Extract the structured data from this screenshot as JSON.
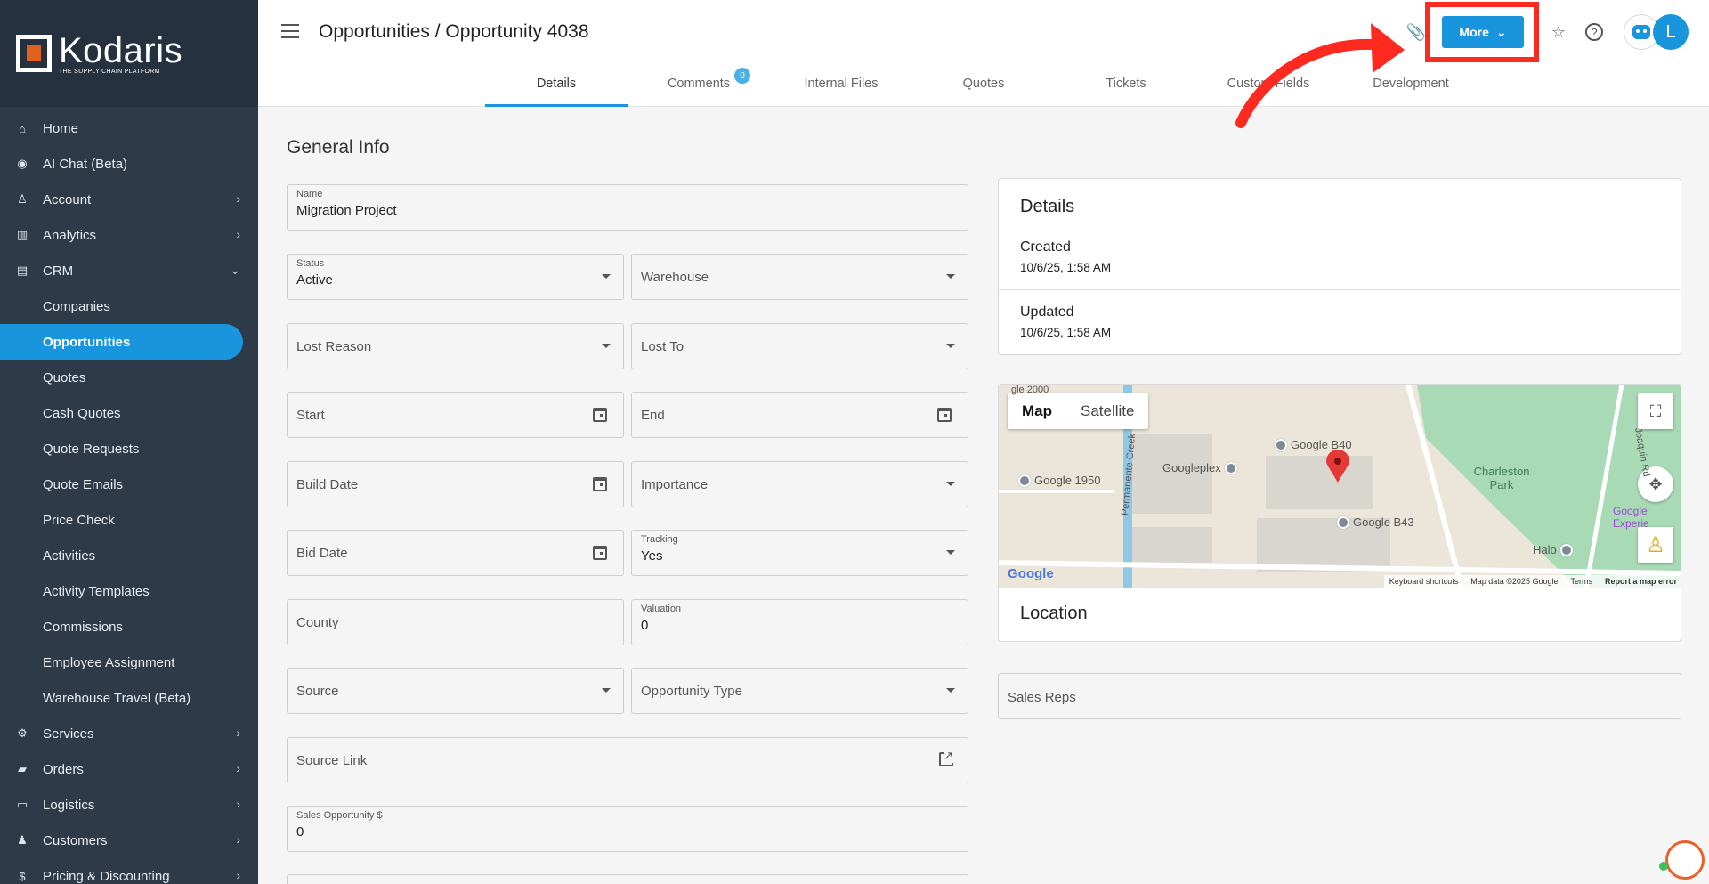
{
  "app": {
    "logo_name": "Kodaris",
    "logo_tagline": "THE SUPPLY CHAIN PLATFORM"
  },
  "sidebar": {
    "items": [
      {
        "label": "Home",
        "icon": "home-icon"
      },
      {
        "label": "AI Chat (Beta)",
        "icon": "robot-icon"
      },
      {
        "label": "Account",
        "icon": "person-icon"
      },
      {
        "label": "Analytics",
        "icon": "chart-icon"
      },
      {
        "label": "CRM",
        "icon": "contacts-icon"
      }
    ],
    "crm_sub": [
      "Companies",
      "Opportunities",
      "Quotes",
      "Cash Quotes",
      "Quote Requests",
      "Quote Emails",
      "Price Check",
      "Activities",
      "Activity Templates",
      "Commissions",
      "Employee Assignment",
      "Warehouse Travel (Beta)"
    ],
    "bottom_items": [
      {
        "label": "Services",
        "icon": "gears-icon"
      },
      {
        "label": "Orders",
        "icon": "truck-icon"
      },
      {
        "label": "Logistics",
        "icon": "shipping-icon"
      },
      {
        "label": "Customers",
        "icon": "group-icon"
      },
      {
        "label": "Pricing & Discounting",
        "icon": "dollar-icon"
      }
    ],
    "active": "Opportunities"
  },
  "header": {
    "title": "Opportunities / Opportunity 4038",
    "more_label": "More",
    "avatar_letter": "L",
    "tabs": [
      {
        "label": "Details",
        "active": true
      },
      {
        "label": "Comments",
        "badge": "0"
      },
      {
        "label": "Internal Files"
      },
      {
        "label": "Quotes"
      },
      {
        "label": "Tickets"
      },
      {
        "label": "Custom Fields"
      },
      {
        "label": "Development"
      }
    ]
  },
  "form": {
    "section_title": "General Info",
    "name": {
      "label": "Name",
      "value": "Migration Project"
    },
    "status": {
      "label": "Status",
      "value": "Active"
    },
    "warehouse": {
      "placeholder": "Warehouse"
    },
    "lost_reason": {
      "placeholder": "Lost Reason"
    },
    "lost_to": {
      "placeholder": "Lost To"
    },
    "start": {
      "placeholder": "Start"
    },
    "end": {
      "placeholder": "End"
    },
    "build_date": {
      "placeholder": "Build Date"
    },
    "importance": {
      "placeholder": "Importance"
    },
    "bid_date": {
      "placeholder": "Bid Date"
    },
    "tracking": {
      "label": "Tracking",
      "value": "Yes"
    },
    "county": {
      "placeholder": "County"
    },
    "valuation": {
      "label": "Valuation",
      "value": "0"
    },
    "source": {
      "placeholder": "Source"
    },
    "opportunity_type": {
      "placeholder": "Opportunity Type"
    },
    "source_link": {
      "placeholder": "Source Link"
    },
    "sales_opportunity": {
      "label": "Sales Opportunity $",
      "value": "0"
    }
  },
  "details": {
    "title": "Details",
    "created_label": "Created",
    "created_value": "10/6/25, 1:58 AM",
    "updated_label": "Updated",
    "updated_value": "10/6/25, 1:58 AM"
  },
  "map": {
    "tab_map": "Map",
    "tab_satellite": "Satellite",
    "poi": [
      "Google B40",
      "Google 1950",
      "Googleplex",
      "Google B43",
      "Charleston Park",
      "Halo",
      "Google Experie",
      "Permanente Creek",
      "Joaquin Rd",
      "gle 2000"
    ],
    "footer": [
      "Keyboard shortcuts",
      "Map data ©2025 Google",
      "Terms",
      "Report a map error"
    ],
    "google_logo": "Google"
  },
  "location": {
    "title": "Location"
  },
  "sales_reps": {
    "placeholder": "Sales Reps"
  },
  "colors": {
    "accent": "#1995dd",
    "sidebar": "#2f3a48",
    "annotation": "#ff2a1f"
  }
}
